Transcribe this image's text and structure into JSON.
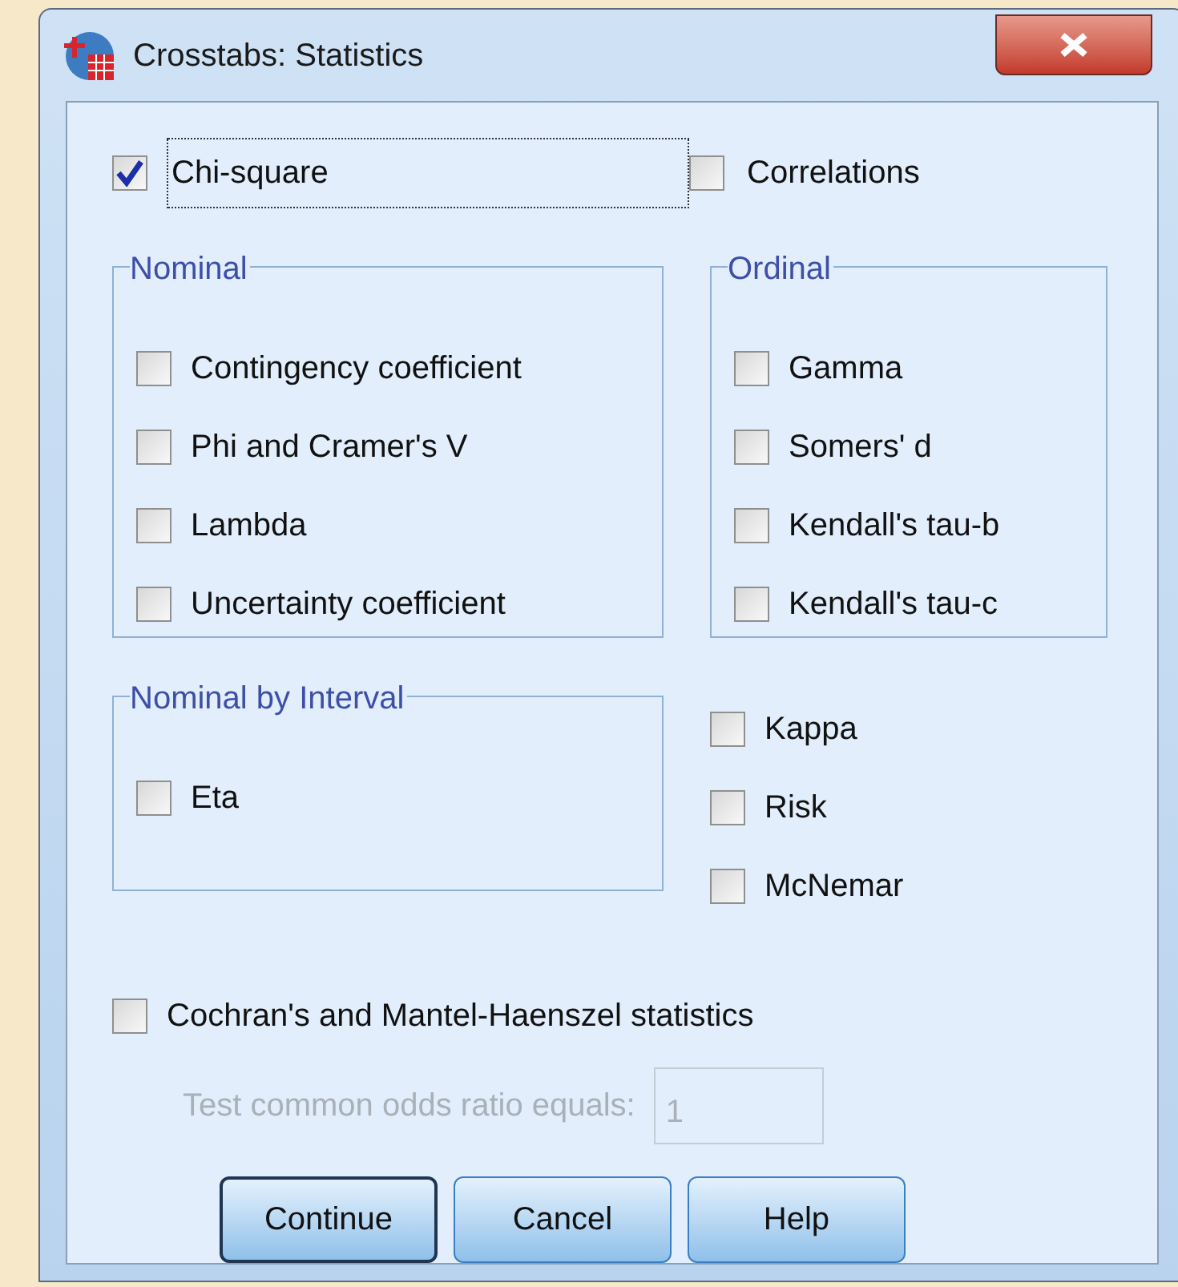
{
  "window": {
    "title": "Crosstabs: Statistics"
  },
  "top_options": [
    {
      "label": "Chi-square",
      "checked": true,
      "focused": true
    },
    {
      "label": "Correlations",
      "checked": false,
      "focused": false
    }
  ],
  "nominal": {
    "title": "Nominal",
    "items": [
      {
        "label": "Contingency coefficient",
        "checked": false
      },
      {
        "label": "Phi and Cramer's V",
        "checked": false
      },
      {
        "label": "Lambda",
        "checked": false
      },
      {
        "label": "Uncertainty coefficient",
        "checked": false
      }
    ]
  },
  "ordinal": {
    "title": "Ordinal",
    "items": [
      {
        "label": "Gamma",
        "checked": false
      },
      {
        "label": "Somers' d",
        "checked": false
      },
      {
        "label": "Kendall's tau-b",
        "checked": false
      },
      {
        "label": "Kendall's tau-c",
        "checked": false
      }
    ]
  },
  "nominal_by_interval": {
    "title": "Nominal by Interval",
    "items": [
      {
        "label": "Eta",
        "checked": false
      }
    ]
  },
  "other_options": [
    {
      "label": "Kappa",
      "checked": false
    },
    {
      "label": "Risk",
      "checked": false
    },
    {
      "label": "McNemar",
      "checked": false
    }
  ],
  "cochran": {
    "label": "Cochran's and Mantel-Haenszel statistics",
    "checked": false
  },
  "odds_ratio": {
    "label": "Test common odds ratio equals:",
    "value": "1",
    "disabled": true
  },
  "buttons": [
    {
      "label": "Continue",
      "default": true
    },
    {
      "label": "Cancel",
      "default": false
    },
    {
      "label": "Help",
      "default": false
    }
  ]
}
